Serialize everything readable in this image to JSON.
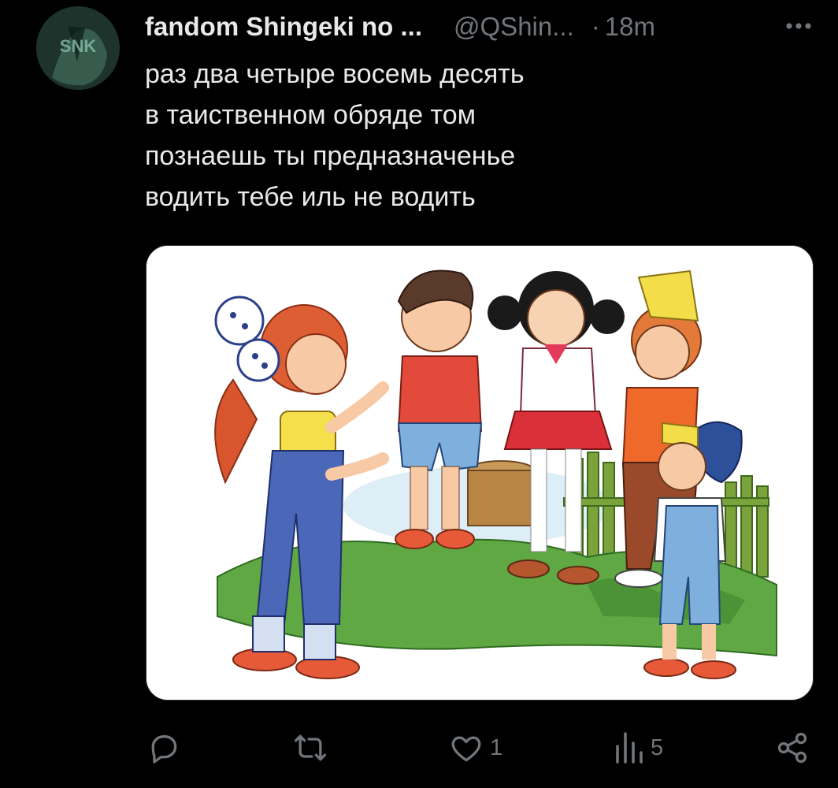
{
  "tweet": {
    "author": {
      "display_name": "fandom Shingeki no ...",
      "handle": "@QShin...",
      "avatar_text": "SNK"
    },
    "separator": "·",
    "time": "18m",
    "more_icon": "more-horizontal-icon",
    "text_lines": [
      "раз два четыре восемь десять",
      "в таиственном обряде том",
      "познаешь ты предназначенье",
      "водить тебе иль не водить"
    ],
    "media": {
      "description": "cartoon of five children standing in a circle on grass by a wooden fence"
    },
    "actions": {
      "reply": {
        "icon": "reply-icon",
        "count": ""
      },
      "retweet": {
        "icon": "retweet-icon",
        "count": ""
      },
      "like": {
        "icon": "heart-icon",
        "count": "1"
      },
      "views": {
        "icon": "views-bar-chart-icon",
        "count": "5"
      },
      "share": {
        "icon": "share-icon",
        "count": ""
      }
    }
  },
  "colors": {
    "background": "#000000",
    "primary_text": "#e7e9ea",
    "secondary_text": "#71767b",
    "border": "#2f3336"
  }
}
